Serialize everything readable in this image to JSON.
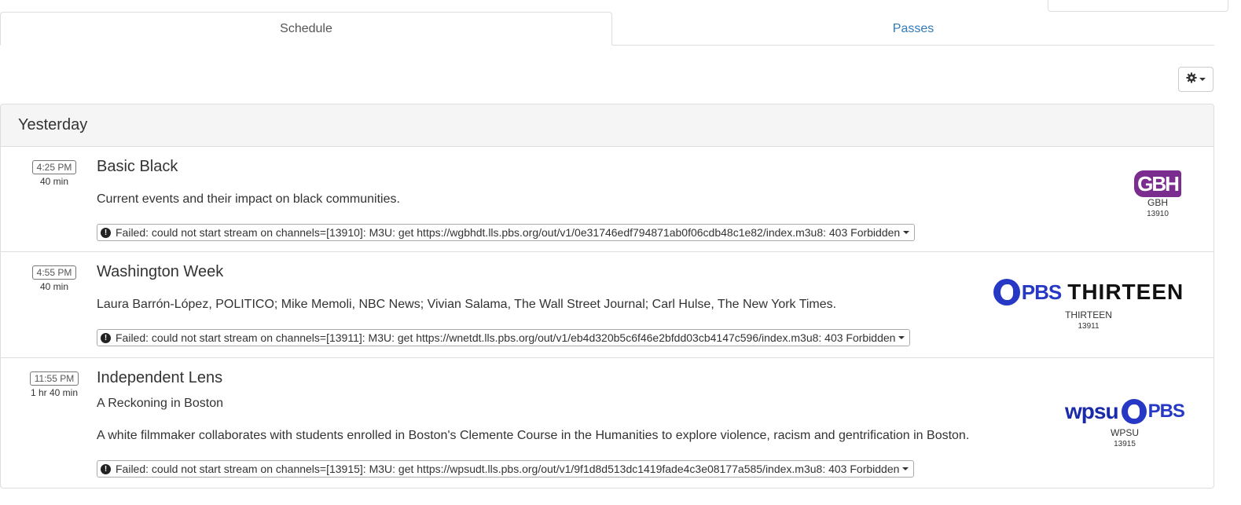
{
  "tabs": [
    {
      "label": "Schedule",
      "active": true
    },
    {
      "label": "Passes",
      "active": false
    }
  ],
  "settings_icon": "gear-icon",
  "day_heading": "Yesterday",
  "programs": [
    {
      "time": "4:25 PM",
      "duration": "40 min",
      "title": "Basic Black",
      "subtitle": "",
      "description": "Current events and their impact on black communities.",
      "error": "Failed: could not start stream on channels=[13910]: M3U: get https://wgbhdt.lls.pbs.org/out/v1/0e31746edf794871ab0f06cdb48c1e82/index.m3u8: 403 Forbidden",
      "channel": {
        "logo_text": "GBH",
        "name": "GBH",
        "number": "13910",
        "color": "#7b2c8f"
      }
    },
    {
      "time": "4:55 PM",
      "duration": "40 min",
      "title": "Washington Week",
      "subtitle": "",
      "description": "Laura Barrón-López, POLITICO; Mike Memoli, NBC News; Vivian Salama, The Wall Street Journal; Carl Hulse, The New York Times.",
      "error": "Failed: could not start stream on channels=[13911]: M3U: get https://wnetdt.lls.pbs.org/out/v1/eb4d320b5c6f46e2bfdd03cb4147c596/index.m3u8: 403 Forbidden",
      "channel": {
        "logo_pbs": "PBS",
        "logo_text": "THIRTEEN",
        "name": "THIRTEEN",
        "number": "13911",
        "color": "#2638c4"
      }
    },
    {
      "time": "11:55 PM",
      "duration": "1 hr 40 min",
      "title": "Independent Lens",
      "subtitle": "A Reckoning in Boston",
      "description": "A white filmmaker collaborates with students enrolled in Boston's Clemente Course in the Humanities to explore violence, racism and gentrification in Boston.",
      "error": "Failed: could not start stream on channels=[13915]: M3U: get https://wpsudt.lls.pbs.org/out/v1/9f1d8d513dc1419fade4c3e08177a585/index.m3u8: 403 Forbidden",
      "channel": {
        "logo_text": "wpsu",
        "logo_pbs": "PBS",
        "name": "WPSU",
        "number": "13915",
        "color": "#2638c4"
      }
    }
  ]
}
